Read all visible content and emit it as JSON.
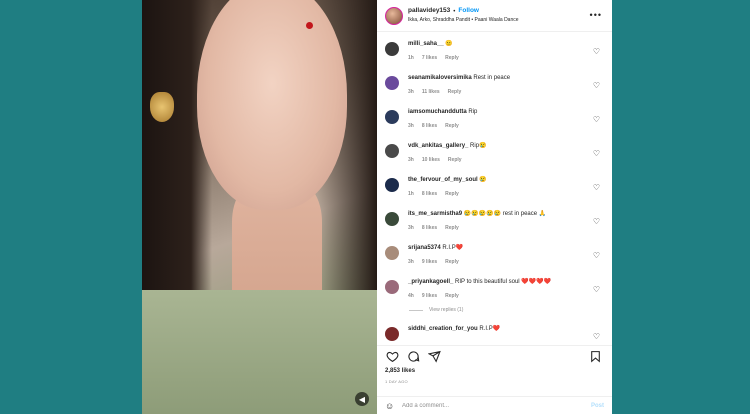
{
  "post": {
    "username": "pallavidey153",
    "follow_label": "Follow",
    "audio": "Ikka, Arko, Shraddha Pandit • Paani Waala Dance",
    "likes": "2,853 likes",
    "posted": "1 DAY AGO",
    "more_icon": "more-horizontal-icon"
  },
  "comments": [
    {
      "user": "milli_saha__",
      "text": "😐",
      "time": "1h",
      "likes": "7 likes",
      "reply": "Reply",
      "avatar_color": "#3b3b3b"
    },
    {
      "user": "seanamikaloversimika",
      "text": "Rest in peace",
      "time": "3h",
      "likes": "11 likes",
      "reply": "Reply",
      "avatar_color": "#6a4a9c"
    },
    {
      "user": "iamsomuchanddutta",
      "text": "Rip",
      "time": "3h",
      "likes": "8 likes",
      "reply": "Reply",
      "avatar_color": "#2b3b5c"
    },
    {
      "user": "vdk_ankitas_gallery_",
      "text": "Rip😢",
      "time": "3h",
      "likes": "10 likes",
      "reply": "Reply",
      "avatar_color": "#4a4a4a"
    },
    {
      "user": "the_fervour_of_my_soul",
      "text": "😢",
      "time": "1h",
      "likes": "8 likes",
      "reply": "Reply",
      "avatar_color": "#1b2b4b"
    },
    {
      "user": "its_me_sarmistha9",
      "text": "😢😢😢😢😢 rest in peace 🙏",
      "time": "3h",
      "likes": "8 likes",
      "reply": "Reply",
      "avatar_color": "#3a4a3a"
    },
    {
      "user": "srijana5374",
      "text": "R.I.P❤️",
      "time": "3h",
      "likes": "9 likes",
      "reply": "Reply",
      "avatar_color": "#a88c7a"
    },
    {
      "user": "_priyankagoell_",
      "text": "RIP to this beautiful soul ❤️❤️❤️❤️",
      "time": "4h",
      "likes": "9 likes",
      "reply": "Reply",
      "avatar_color": "#9a6a7a"
    },
    {
      "user": "siddhi_creation_for_you",
      "text": "R.I.P❤️",
      "time": "",
      "likes": "",
      "reply": "",
      "avatar_color": "#7a2a2a"
    }
  ],
  "view_replies": "View replies (1)",
  "add_comment": {
    "placeholder": "Add a comment...",
    "post_label": "Post"
  }
}
